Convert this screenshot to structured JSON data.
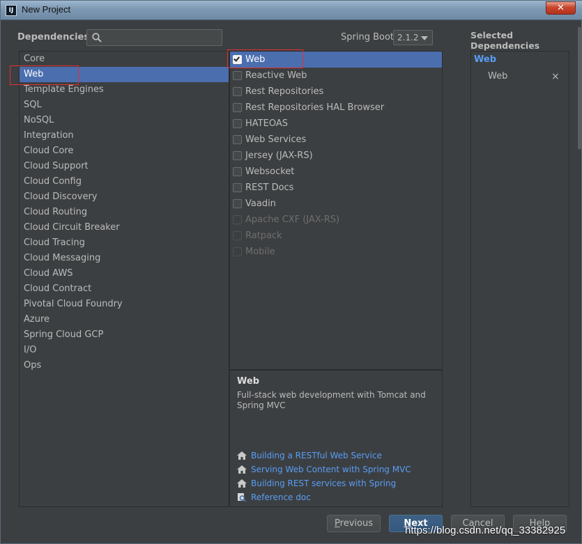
{
  "window": {
    "title": "New Project",
    "app_icon": "IJ",
    "close_label": "✕"
  },
  "header": {
    "dependencies_label": "Dependencies",
    "search_value": "",
    "spring_boot_label": "Spring Boot",
    "spring_boot_version": "2.1.2",
    "selected_label": "Selected Dependencies"
  },
  "categories": [
    {
      "label": "Core"
    },
    {
      "label": "Web"
    },
    {
      "label": "Template Engines"
    },
    {
      "label": "SQL"
    },
    {
      "label": "NoSQL"
    },
    {
      "label": "Integration"
    },
    {
      "label": "Cloud Core"
    },
    {
      "label": "Cloud Support"
    },
    {
      "label": "Cloud Config"
    },
    {
      "label": "Cloud Discovery"
    },
    {
      "label": "Cloud Routing"
    },
    {
      "label": "Cloud Circuit Breaker"
    },
    {
      "label": "Cloud Tracing"
    },
    {
      "label": "Cloud Messaging"
    },
    {
      "label": "Cloud AWS"
    },
    {
      "label": "Cloud Contract"
    },
    {
      "label": "Pivotal Cloud Foundry"
    },
    {
      "label": "Azure"
    },
    {
      "label": "Spring Cloud GCP"
    },
    {
      "label": "I/O"
    },
    {
      "label": "Ops"
    }
  ],
  "selected_category_index": 1,
  "dependencies": [
    {
      "label": "Web",
      "checked": true,
      "enabled": true
    },
    {
      "label": "Reactive Web",
      "checked": false,
      "enabled": true
    },
    {
      "label": "Rest Repositories",
      "checked": false,
      "enabled": true
    },
    {
      "label": "Rest Repositories HAL Browser",
      "checked": false,
      "enabled": true
    },
    {
      "label": "HATEOAS",
      "checked": false,
      "enabled": true
    },
    {
      "label": "Web Services",
      "checked": false,
      "enabled": true
    },
    {
      "label": "Jersey (JAX-RS)",
      "checked": false,
      "enabled": true
    },
    {
      "label": "Websocket",
      "checked": false,
      "enabled": true
    },
    {
      "label": "REST Docs",
      "checked": false,
      "enabled": true
    },
    {
      "label": "Vaadin",
      "checked": false,
      "enabled": true
    },
    {
      "label": "Apache CXF (JAX-RS)",
      "checked": false,
      "enabled": false
    },
    {
      "label": "Ratpack",
      "checked": false,
      "enabled": false
    },
    {
      "label": "Mobile",
      "checked": false,
      "enabled": false
    }
  ],
  "description": {
    "title": "Web",
    "text": "Full-stack web development with Tomcat and Spring MVC",
    "links": [
      {
        "label": "Building a RESTful Web Service",
        "icon": "home-icon"
      },
      {
        "label": "Serving Web Content with Spring MVC",
        "icon": "home-icon"
      },
      {
        "label": "Building REST services with Spring",
        "icon": "home-icon"
      },
      {
        "label": "Reference doc",
        "icon": "doc-search-icon"
      }
    ]
  },
  "selected": {
    "group": "Web",
    "items": [
      {
        "label": "Web",
        "remove": "×"
      }
    ]
  },
  "buttons": {
    "previous_first": "P",
    "previous_rest": "revious",
    "next_first": "N",
    "next_rest": "ext",
    "cancel": "Cancel",
    "help": "Help"
  },
  "watermark": "https://blog.csdn.net/qq_33382925",
  "colors": {
    "selection": "#4b6eaf",
    "link": "#589df6",
    "background": "#3c3f41",
    "highlight_box": "#e03030"
  }
}
